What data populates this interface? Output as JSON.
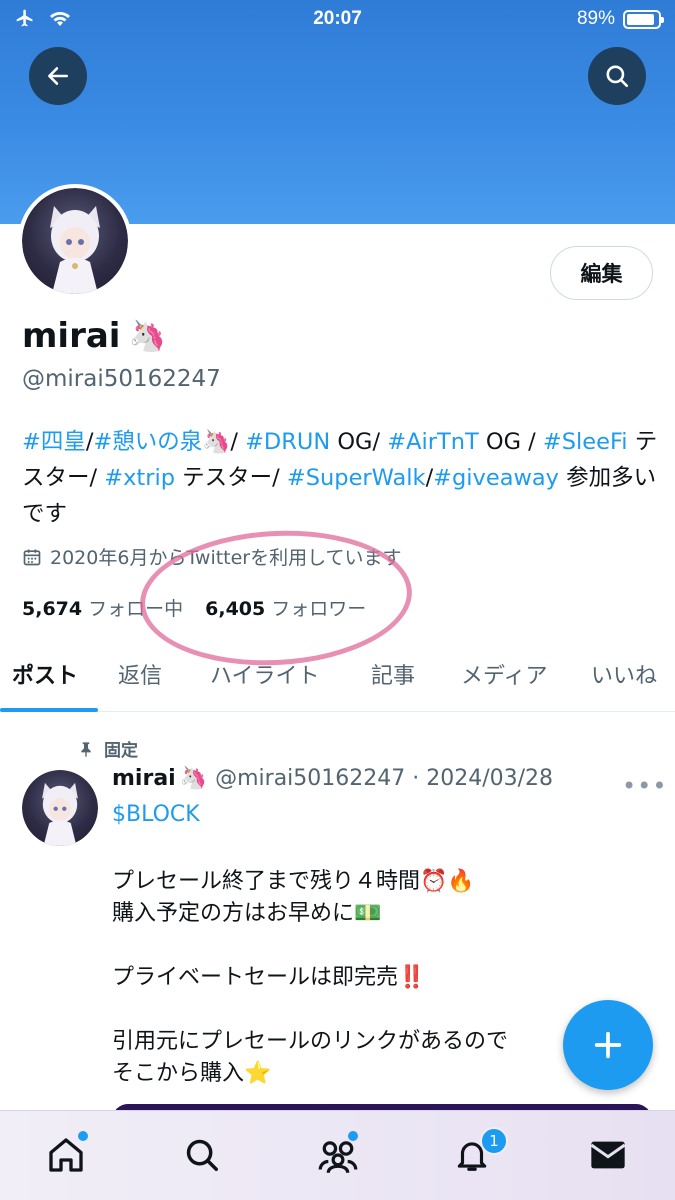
{
  "status_bar": {
    "time": "20:07",
    "battery": "89%",
    "battery_level": 0.89
  },
  "profile": {
    "display_name": "mirai",
    "display_name_emoji": "🦄",
    "handle": "@mirai50162247",
    "edit_label": "編集",
    "bio": [
      {
        "text": "#四皇",
        "tag": true
      },
      {
        "text": "/",
        "tag": false
      },
      {
        "text": "#憩いの泉",
        "tag": true
      },
      {
        "text": "🦄/ ",
        "tag": false
      },
      {
        "text": "#DRUN",
        "tag": true
      },
      {
        "text": " OG/ ",
        "tag": false
      },
      {
        "text": "#AirTnT",
        "tag": true
      },
      {
        "text": " OG / ",
        "tag": false
      },
      {
        "text": "#SleeFi",
        "tag": true
      },
      {
        "text": " テスター/ ",
        "tag": false
      },
      {
        "text": "#xtrip",
        "tag": true
      },
      {
        "text": " テスター/ ",
        "tag": false
      },
      {
        "text": "#SuperWalk",
        "tag": true
      },
      {
        "text": "/",
        "tag": false
      },
      {
        "text": "#giveaway",
        "tag": true
      },
      {
        "text": " 参加多いです",
        "tag": false
      }
    ],
    "joined": "2020年6月からTwitterを利用しています",
    "following_count": "5,674",
    "following_label": "フォロー中",
    "followers_count": "6,405",
    "followers_label": "フォロワー"
  },
  "tabs": [
    {
      "label": "ポスト",
      "active": true
    },
    {
      "label": "返信",
      "active": false
    },
    {
      "label": "ハイライト",
      "active": false
    },
    {
      "label": "記事",
      "active": false
    },
    {
      "label": "メディア",
      "active": false
    },
    {
      "label": "いいね",
      "active": false
    }
  ],
  "pinned_post": {
    "pinned_label": "固定",
    "name": "mirai",
    "name_emoji": "🦄",
    "meta": "@mirai50162247 · 2024/03/28",
    "cashtag": "$BLOCK",
    "paragraphs": [
      "プレセール終了まで残り４時間⏰🔥\n購入予定の方はお早めに💵",
      "プライベートセールは即完売‼️",
      "引用元にプレセールのリンクがあるので\nそこから購入⭐"
    ]
  },
  "bottom_nav": {
    "items": [
      "home-icon",
      "search-icon",
      "communities-icon",
      "notifications-icon",
      "messages-icon"
    ],
    "notification_badge": "1"
  },
  "colors": {
    "accent": "#1d9bf0",
    "banner": "#3a8be3",
    "highlight": "#e06b9a"
  }
}
